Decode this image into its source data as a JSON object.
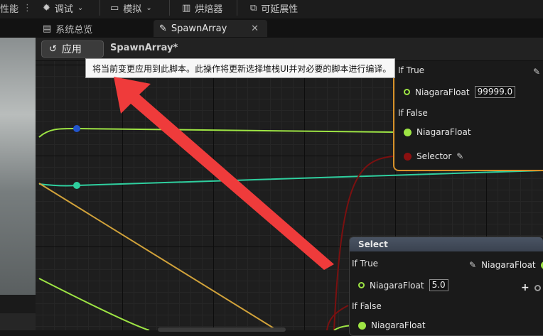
{
  "toolbar": {
    "items": [
      {
        "label": "性能"
      },
      {
        "label": "调试"
      },
      {
        "label": "模拟"
      },
      {
        "label": "烘焙器"
      },
      {
        "label": "可延展性"
      }
    ]
  },
  "tabs": [
    {
      "label": "系统总览"
    },
    {
      "label": "SpawnArray"
    }
  ],
  "editor": {
    "apply_label": "应用",
    "graph_title": "SpawnArray*"
  },
  "tooltip": {
    "text": "将当前变更应用到此脚本。此操作将更新选择堆栈UI并对必要的脚本进行编译。"
  },
  "node_top": {
    "if_true_label": "If True",
    "if_true_pin": "NiagaraFloat",
    "if_true_value": "99999.0",
    "if_false_label": "If False",
    "if_false_pin": "NiagaraFloat",
    "selector_pin": "Selector"
  },
  "node_bottom": {
    "title": "Select",
    "if_true_label": "If True",
    "if_true_pin": "NiagaraFloat",
    "if_true_value": "5.0",
    "output_pin": "NiagaraFloat",
    "if_false_label": "If False",
    "if_false_pin": "NiagaraFloat"
  },
  "colors": {
    "float_pin": "#9ee544",
    "teal_wire": "#2fcf9f",
    "orange_wire": "#d1a23a",
    "red_wire": "#7a1010",
    "arrow": "#ef3b3b",
    "selected_border": "#d8922a"
  }
}
